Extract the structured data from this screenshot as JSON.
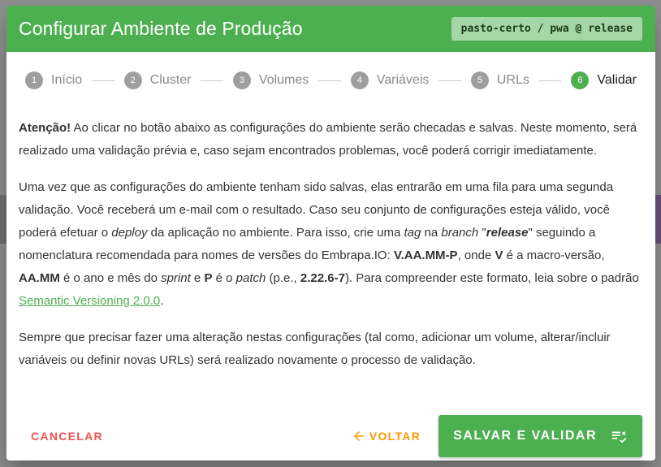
{
  "dialog": {
    "title": "Configurar Ambiente de Produção",
    "repo_chip": {
      "project": "pasto-certo",
      "sep1": " / ",
      "app": "pwa",
      "sep2": " @ ",
      "branch": "release"
    }
  },
  "stepper": {
    "steps": [
      {
        "num": "1",
        "label": "Início"
      },
      {
        "num": "2",
        "label": "Cluster"
      },
      {
        "num": "3",
        "label": "Volumes"
      },
      {
        "num": "4",
        "label": "Variáveis"
      },
      {
        "num": "5",
        "label": "URLs"
      },
      {
        "num": "6",
        "label": "Validar"
      }
    ],
    "active_step": 6
  },
  "content": {
    "p1": {
      "bold": "Atenção!",
      "text": " Ao clicar no botão abaixo as configurações do ambiente serão checadas e salvas. Neste momento, será realizado uma validação prévia e, caso sejam encontrados problemas, você poderá corrigir imediatamente."
    },
    "p2": {
      "t1": "Uma vez que as configurações do ambiente tenham sido salvas, elas entrarão em uma fila para uma segunda validação. Você receberá um e-mail com o resultado. Caso seu conjunto de configurações esteja válido, você poderá efetuar o ",
      "i_deploy": "deploy",
      "t2": " da aplicação no ambiente. Para isso, crie uma ",
      "i_tag": "tag",
      "t3": " na ",
      "i_branch": "branch",
      "t4": " \"",
      "bi_release": "release",
      "t5": "\" seguindo a nomenclatura recomendada para nomes de versões do Embrapa.IO: ",
      "b_pattern": "V.AA.MM-P",
      "t6": ", onde ",
      "b_v": "V",
      "t7": " é a macro-versão, ",
      "b_aamm": "AA.MM",
      "t8": " é o ano e mês do ",
      "i_sprint": "sprint",
      "t9": " e ",
      "b_p": "P",
      "t10": " é o ",
      "i_patch": "patch",
      "t11": " (p.e., ",
      "b_example": "2.22.6-7",
      "t12": "). Para compreender este formato, leia sobre o padrão ",
      "link": "Semantic Versioning 2.0.0",
      "t13": "."
    },
    "p3": "Sempre que precisar fazer uma alteração nestas configurações (tal como, adicionar um volume, alterar/incluir variáveis ou definir novas URLs) será realizado novamente o processo de validação."
  },
  "actions": {
    "cancel_label": "CANCELAR",
    "back_label": "VOLTAR",
    "save_label": "SALVAR E VALIDAR"
  },
  "colors": {
    "primary": "#4caf50",
    "cancel": "#f05252",
    "back": "#ff9800"
  },
  "icons": {
    "back": "arrow-left-icon",
    "save": "playlist-check-icon"
  }
}
